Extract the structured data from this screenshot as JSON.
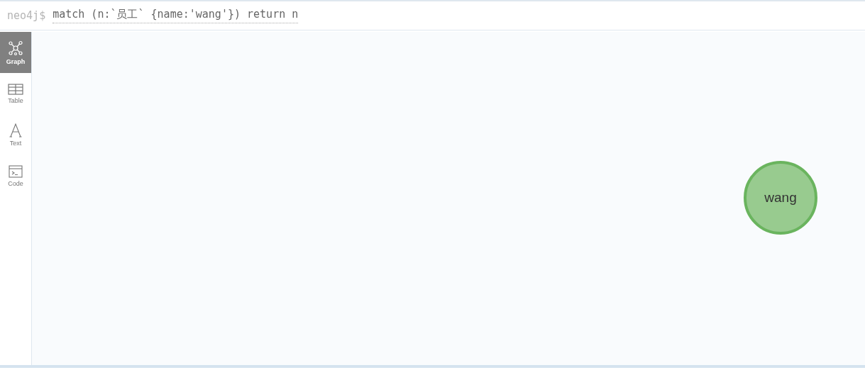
{
  "prompt": {
    "label": "neo4j$",
    "query": "match (n:`员工` {name:'wang'}) return n"
  },
  "view_tabs": [
    {
      "label": "Graph",
      "kind": "graph",
      "selected": true
    },
    {
      "label": "Table",
      "kind": "table",
      "selected": false
    },
    {
      "label": "Text",
      "kind": "text",
      "selected": false
    },
    {
      "label": "Code",
      "kind": "code",
      "selected": false
    }
  ],
  "graph": {
    "nodes": [
      {
        "caption": "wang",
        "color": "#98cb8f"
      }
    ]
  }
}
